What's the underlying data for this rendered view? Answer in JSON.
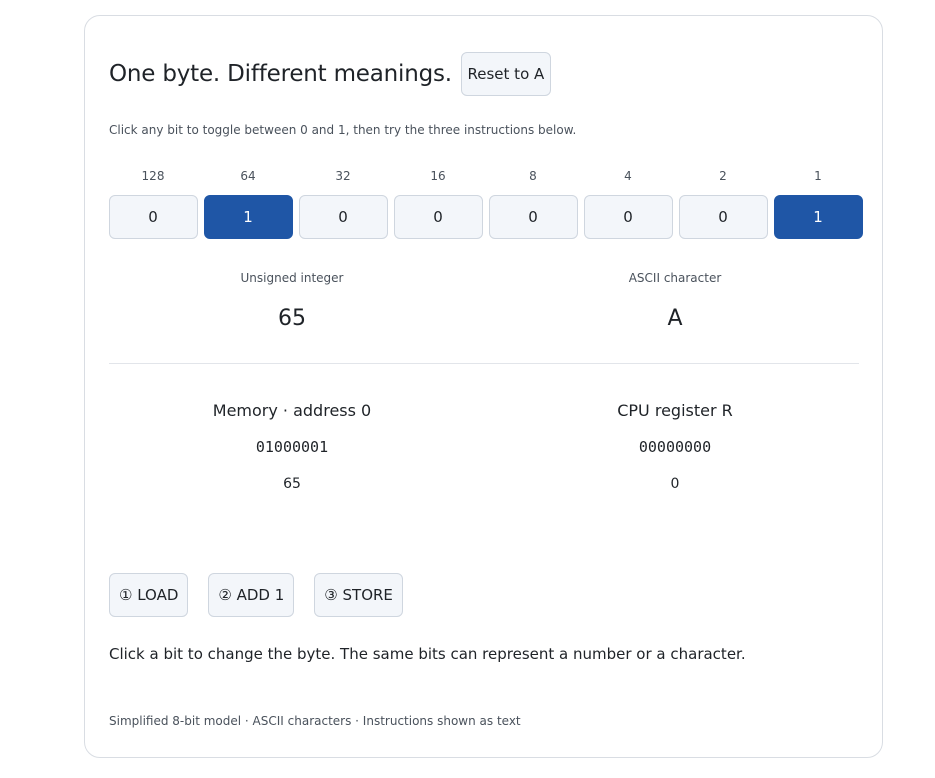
{
  "header": {
    "title": "One byte. Different meanings.",
    "reset_label": "Reset to A"
  },
  "hint": "Click any bit to toggle between 0 and 1, then try the three instructions below.",
  "bits": [
    {
      "weight": "128",
      "value": "0",
      "on": false
    },
    {
      "weight": "64",
      "value": "1",
      "on": true
    },
    {
      "weight": "32",
      "value": "0",
      "on": false
    },
    {
      "weight": "16",
      "value": "0",
      "on": false
    },
    {
      "weight": "8",
      "value": "0",
      "on": false
    },
    {
      "weight": "4",
      "value": "0",
      "on": false
    },
    {
      "weight": "2",
      "value": "0",
      "on": false
    },
    {
      "weight": "1",
      "value": "1",
      "on": true
    }
  ],
  "readouts": {
    "unsigned_label": "Unsigned integer",
    "unsigned_value": "65",
    "ascii_label": "ASCII character",
    "ascii_value": "A"
  },
  "memory": {
    "title": "Memory · address 0",
    "bits": "01000001",
    "value": "65"
  },
  "cpu": {
    "title": "CPU register R",
    "bits": "00000000",
    "value": "0"
  },
  "instructions": {
    "load": "① LOAD",
    "add": "② ADD 1",
    "store": "③ STORE"
  },
  "status": "Click a bit to change the byte. The same bits can represent a number or a character.",
  "footer": "Simplified 8-bit model · ASCII characters · Instructions shown as text",
  "colors": {
    "bit_on": "#1f56a6",
    "bit_off": "#f3f6fa"
  }
}
